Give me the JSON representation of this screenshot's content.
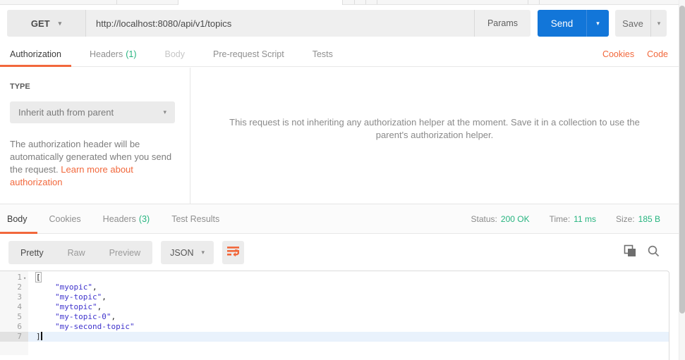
{
  "request": {
    "method": "GET",
    "url": "http://localhost:8080/api/v1/topics",
    "params_label": "Params",
    "send_label": "Send",
    "save_label": "Save",
    "tabs": [
      {
        "label": "Authorization"
      },
      {
        "label": "Headers",
        "badge": "(1)"
      },
      {
        "label": "Body"
      },
      {
        "label": "Pre-request Script"
      },
      {
        "label": "Tests"
      }
    ],
    "cookies_link": "Cookies",
    "code_link": "Code"
  },
  "authorization": {
    "type_label": "TYPE",
    "type_value": "Inherit auth from parent",
    "description": "The authorization header will be automatically generated when you send the request. ",
    "learn_more_link": "Learn more about authorization",
    "helper_message": "This request is not inheriting any authorization helper at the moment. Save it in a collection to use the parent's authorization helper."
  },
  "response": {
    "tabs": [
      {
        "label": "Body"
      },
      {
        "label": "Cookies"
      },
      {
        "label": "Headers",
        "badge": "(3)"
      },
      {
        "label": "Test Results"
      }
    ],
    "meta": {
      "status_label": "Status:",
      "status_value": "200 OK",
      "time_label": "Time:",
      "time_value": "11 ms",
      "size_label": "Size:",
      "size_value": "185 B"
    },
    "view_modes": {
      "pretty": "Pretty",
      "raw": "Raw",
      "preview": "Preview"
    },
    "format": "JSON"
  },
  "editor_content": {
    "lines": [
      {
        "num": "1",
        "text": "["
      },
      {
        "num": "2",
        "string": "\"myopic\"",
        "suffix": ","
      },
      {
        "num": "3",
        "string": "\"my-topic\"",
        "suffix": ","
      },
      {
        "num": "4",
        "string": "\"mytopic\"",
        "suffix": ","
      },
      {
        "num": "5",
        "string": "\"my-topic-0\"",
        "suffix": ","
      },
      {
        "num": "6",
        "string": "\"my-second-topic\"",
        "suffix": ""
      },
      {
        "num": "7",
        "text": "]"
      }
    ]
  },
  "colors": {
    "accent_orange": "#f2683c",
    "send_blue": "#1276d9",
    "success_green": "#26b47f",
    "json_string_blue": "#3f33cc"
  }
}
